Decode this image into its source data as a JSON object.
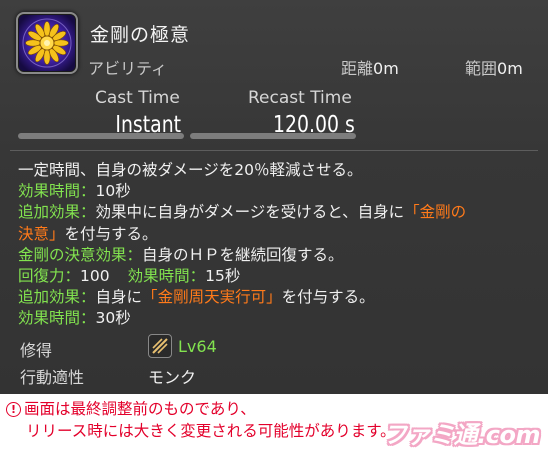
{
  "tooltip": {
    "name": "金剛の極意",
    "type": "アビリティ",
    "distance_label": "距離",
    "distance_value": "0m",
    "range_label": "範囲",
    "range_value": "0m",
    "cast_label": "Cast Time",
    "cast_value": "Instant",
    "recast_label": "Recast Time",
    "recast_value": "120.00 s",
    "icon": "vajra-lotus-icon",
    "description": {
      "line1": "一定時間、自身の被ダメージを20％軽減させる。",
      "duration_label": "効果時間",
      "colon": "：",
      "duration_value": "10秒",
      "extra_label": "追加効果",
      "extra_text_1": "効果中に自身がダメージを受けると、自身に",
      "quote_open": "「",
      "quote_close": "」",
      "status_1a": "金剛の",
      "status_1b": "決意",
      "extra_text_2": "を付与する。",
      "status_1_full": "金剛の決意効果",
      "status_1_effect": "自身のＨＰを継続回復する。",
      "potency_label": "回復力",
      "potency_value": "100",
      "duration2_label": "効果時間",
      "duration2_value": "15秒",
      "extra2_label": "追加効果",
      "extra2_text_1": "自身に",
      "status_2": "金剛周天実行可",
      "extra2_text_2": "を付与する。",
      "duration3_label": "効果時間",
      "duration3_value": "30秒"
    },
    "acquired_label": "修得",
    "acquired_level": "Lv64",
    "affinity_label": "行動適性",
    "affinity_value": "モンク",
    "job_icon": "monk-job-icon"
  },
  "notice": {
    "line1": "画面は最終調整前のものであり、",
    "line2": "リリース時には大きく変更される可能性があります。"
  },
  "logo": {
    "text": "ファミ通.com"
  },
  "colors": {
    "green": "#82e34f",
    "orange": "#ff7a1a",
    "notice_red": "#e3002b",
    "panel": "#3a3a3a"
  }
}
